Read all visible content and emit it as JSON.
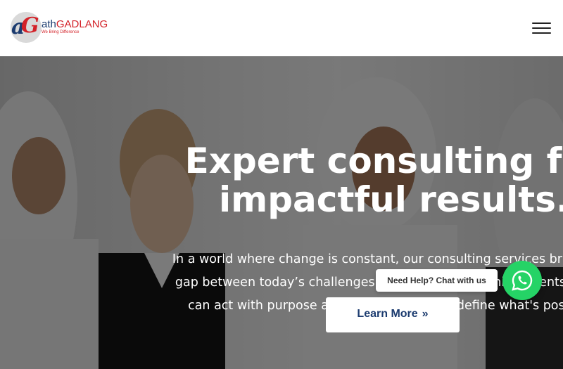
{
  "header": {
    "logo": {
      "mark_a": "a",
      "mark_g": "G",
      "word_ath": "ath",
      "word_gadlang": "GADLANG",
      "tagline": "We Bring Difference"
    },
    "menu_icon": "hamburger-menu-icon"
  },
  "hero": {
    "title_line1": "Expert consulting for",
    "title_line2": "impactful results.",
    "text_line1": "In a world where change is constant, our consulting services bridge the",
    "text_line2": "gap between today’s challenges and tomorrow’s achievements so you",
    "text_line3": "can act with purpose and precision. Let's redefine what's possible.",
    "button_label": "Learn More",
    "button_icon": "chevron-double-right-icon"
  },
  "chat": {
    "bubble_text": "Need Help? Chat with us",
    "icon": "whatsapp-icon"
  },
  "colors": {
    "brand_blue": "#1b3b6f",
    "brand_red": "#d32027",
    "whatsapp_green": "#25d366"
  }
}
